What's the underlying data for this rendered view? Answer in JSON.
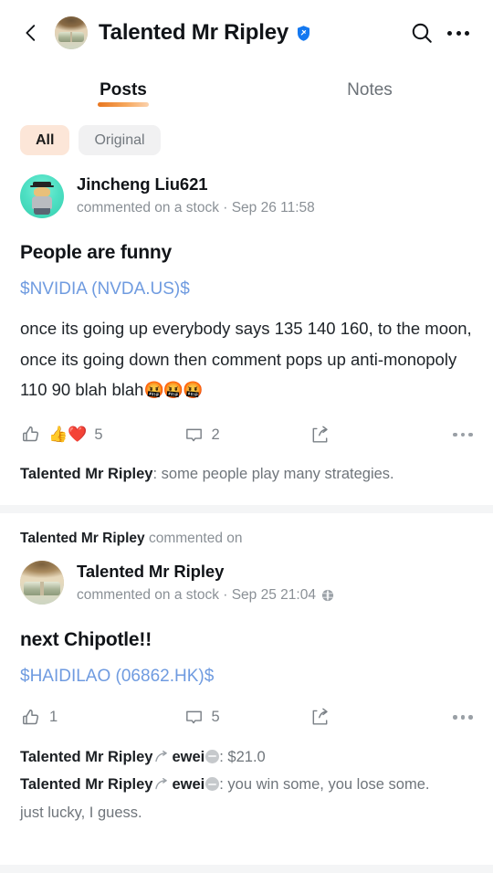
{
  "header": {
    "back_icon": "chevron-left-icon",
    "avatar_icon": "profile-avatar",
    "title": "Talented Mr Ripley",
    "verified_icon": "verified-shield-icon",
    "search_icon": "search-icon",
    "more_icon": "more-options-icon"
  },
  "tabs": [
    {
      "label": "Posts",
      "active": true
    },
    {
      "label": "Notes",
      "active": false
    }
  ],
  "filters": [
    {
      "label": "All",
      "selected": true
    },
    {
      "label": "Original",
      "selected": false
    }
  ],
  "colors": {
    "accent_underline": "#e8761f",
    "chip_selected_bg": "#fce6d8",
    "chip_unselected_bg": "#f1f1f2",
    "stock_link": "#6f9be0",
    "verified_blue": "#1478f0",
    "divider": "#f4f5f6"
  },
  "posts": [
    {
      "repost_header": null,
      "author": "Jincheng Liu621",
      "avatar_icon": "cartoon-avatar",
      "meta": "commented on a stock · Sep 26 11:58",
      "privacy_icon": null,
      "title": "People are funny",
      "stock_tag": "$NVIDIA (NVDA.US)$",
      "body": "once its going up everybody says 135 140 160, to the moon, once its going down then comment pops up anti-monopoly 110 90 blah blah",
      "body_emoji": "🤬🤬🤬",
      "actions": {
        "like_icon": "thumbs-up-icon",
        "reactions": "👍❤️",
        "like_count": "5",
        "comment_icon": "comment-bubble-icon",
        "comment_count": "2",
        "share_icon": "share-icon",
        "more_icon": "more-options-icon"
      },
      "comments": [
        {
          "author": "Talented Mr Ripley",
          "reply_to": null,
          "text": ": some people play many strategies."
        }
      ],
      "comment_continuation": null
    },
    {
      "repost_header": {
        "author": "Talented Mr Ripley",
        "action": "commented on"
      },
      "author": "Talented Mr Ripley",
      "avatar_icon": "profile-avatar",
      "meta": "commented on a stock · Sep 25 21:04",
      "privacy_icon": "globe-icon",
      "title": "next Chipotle!!",
      "stock_tag": "$HAIDILAO (06862.HK)$",
      "body": null,
      "body_emoji": null,
      "actions": {
        "like_icon": "thumbs-up-icon",
        "reactions": "",
        "like_count": "1",
        "comment_icon": "comment-bubble-icon",
        "comment_count": "5",
        "share_icon": "share-icon",
        "more_icon": "more-options-icon"
      },
      "comments": [
        {
          "author": "Talented Mr Ripley",
          "reply_to": "ewei",
          "text": ": $21.0"
        },
        {
          "author": "Talented Mr Ripley",
          "reply_to": "ewei",
          "text": ": you win some, you lose some."
        }
      ],
      "comment_continuation": "just lucky, I guess."
    }
  ]
}
